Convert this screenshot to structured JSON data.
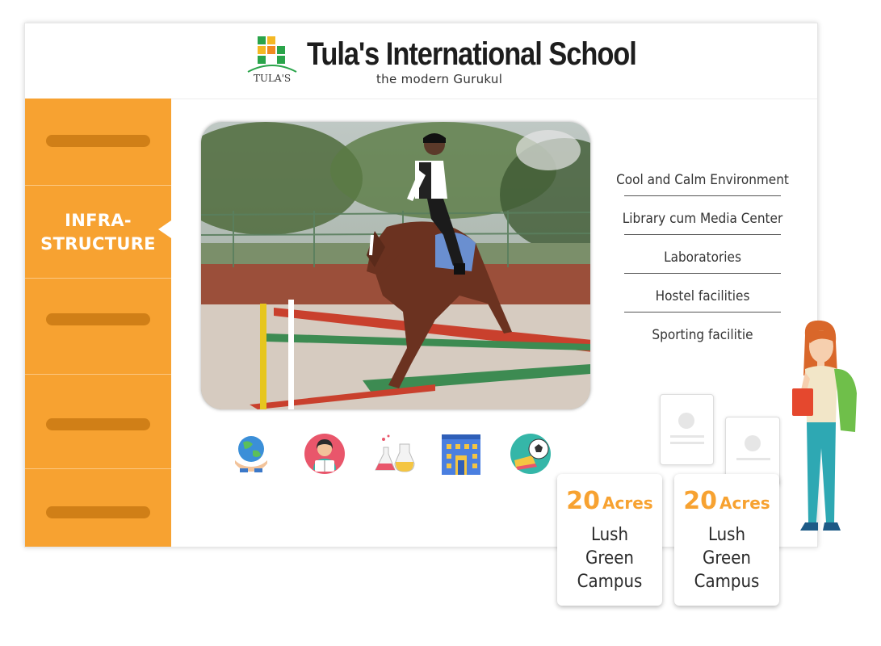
{
  "header": {
    "logo_text": "TULA'S",
    "school_name": "Tula's International School",
    "tagline": "the modern Gurukul"
  },
  "sidebar": {
    "active_label_line1": "INFRA-",
    "active_label_line2": "STRUCTURE"
  },
  "features": [
    "Cool and Calm Environment",
    "Library cum Media Center",
    "Laboratories",
    "Hostel facilities",
    "Sporting facilitie"
  ],
  "icons": [
    "globe-hands-icon",
    "reading-student-icon",
    "lab-flasks-icon",
    "school-building-icon",
    "sports-ball-icon"
  ],
  "acres_cards": [
    {
      "number": "20",
      "unit": "Acres",
      "desc_line1": "Lush",
      "desc_line2": "Green",
      "desc_line3": "Campus"
    },
    {
      "number": "20",
      "unit": "Acres",
      "desc_line1": "Lush",
      "desc_line2": "Green",
      "desc_line3": "Campus"
    }
  ],
  "colors": {
    "accent": "#f7a231",
    "sidebar_pill": "#d07f17"
  }
}
